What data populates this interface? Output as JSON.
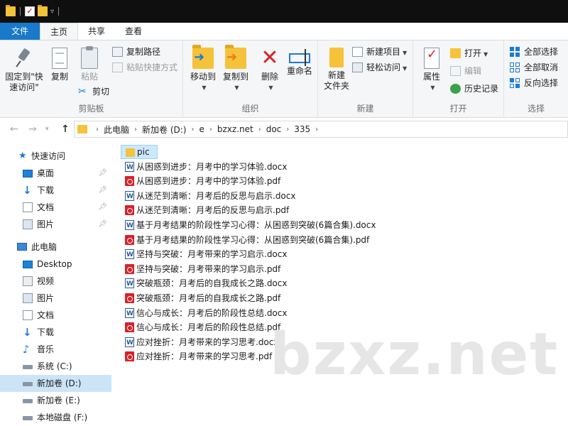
{
  "titlebar": {},
  "tabs": [
    "文件",
    "主页",
    "共享",
    "查看"
  ],
  "ribbon": {
    "clipboard": {
      "label": "剪贴板",
      "pin_quick": "固定到\"快\n速访问\"",
      "copy": "复制",
      "paste": "粘贴",
      "copy_path": "复制路径",
      "paste_shortcut": "粘贴快捷方式",
      "cut": "剪切"
    },
    "organize": {
      "label": "组织",
      "move_to": "移动到",
      "copy_to": "复制到",
      "delete": "删除",
      "rename": "重命名"
    },
    "new": {
      "label": "新建",
      "new_folder": "新建\n文件夹",
      "new_item": "新建项目",
      "easy_access": "轻松访问"
    },
    "open": {
      "label": "打开",
      "properties": "属性",
      "open": "打开",
      "edit": "编辑",
      "history": "历史记录"
    },
    "select": {
      "label": "选择",
      "select_all": "全部选择",
      "select_none": "全部取消",
      "invert": "反向选择"
    }
  },
  "address": {
    "crumbs": [
      "此电脑",
      "新加卷 (D:)",
      "e",
      "bzxz.net",
      "doc",
      "335"
    ]
  },
  "navpane": {
    "quick_access": "快速访问",
    "quick_items": [
      "桌面",
      "下载",
      "文档",
      "图片"
    ],
    "this_pc": "此电脑",
    "pc_items": [
      "Desktop",
      "视频",
      "图片",
      "文档",
      "下载",
      "音乐",
      "系统 (C:)",
      "新加卷 (D:)",
      "新加卷 (E:)",
      "本地磁盘 (F:)"
    ]
  },
  "files": [
    {
      "name": "pic",
      "type": "folder"
    },
    {
      "name": "从困惑到进步：月考中的学习体验.docx",
      "type": "docx"
    },
    {
      "name": "从困惑到进步：月考中的学习体验.pdf",
      "type": "pdf"
    },
    {
      "name": "从迷茫到清晰：月考后的反思与启示.docx",
      "type": "docx"
    },
    {
      "name": "从迷茫到清晰：月考后的反思与启示.pdf",
      "type": "pdf"
    },
    {
      "name": "基于月考结果的阶段性学习心得：从困惑到突破(6篇合集).docx",
      "type": "docx"
    },
    {
      "name": "基于月考结果的阶段性学习心得：从困惑到突破(6篇合集).pdf",
      "type": "pdf"
    },
    {
      "name": "坚持与突破：月考带来的学习启示.docx",
      "type": "docx"
    },
    {
      "name": "坚持与突破：月考带来的学习启示.pdf",
      "type": "pdf"
    },
    {
      "name": "突破瓶颈：月考后的自我成长之路.docx",
      "type": "docx"
    },
    {
      "name": "突破瓶颈：月考后的自我成长之路.pdf",
      "type": "pdf"
    },
    {
      "name": "信心与成长：月考后的阶段性总结.docx",
      "type": "docx"
    },
    {
      "name": "信心与成长：月考后的阶段性总结.pdf",
      "type": "pdf"
    },
    {
      "name": "应对挫折：月考带来的学习思考.docx",
      "type": "docx"
    },
    {
      "name": "应对挫折：月考带来的学习思考.pdf",
      "type": "pdf"
    }
  ],
  "watermark": "bzxz.net"
}
